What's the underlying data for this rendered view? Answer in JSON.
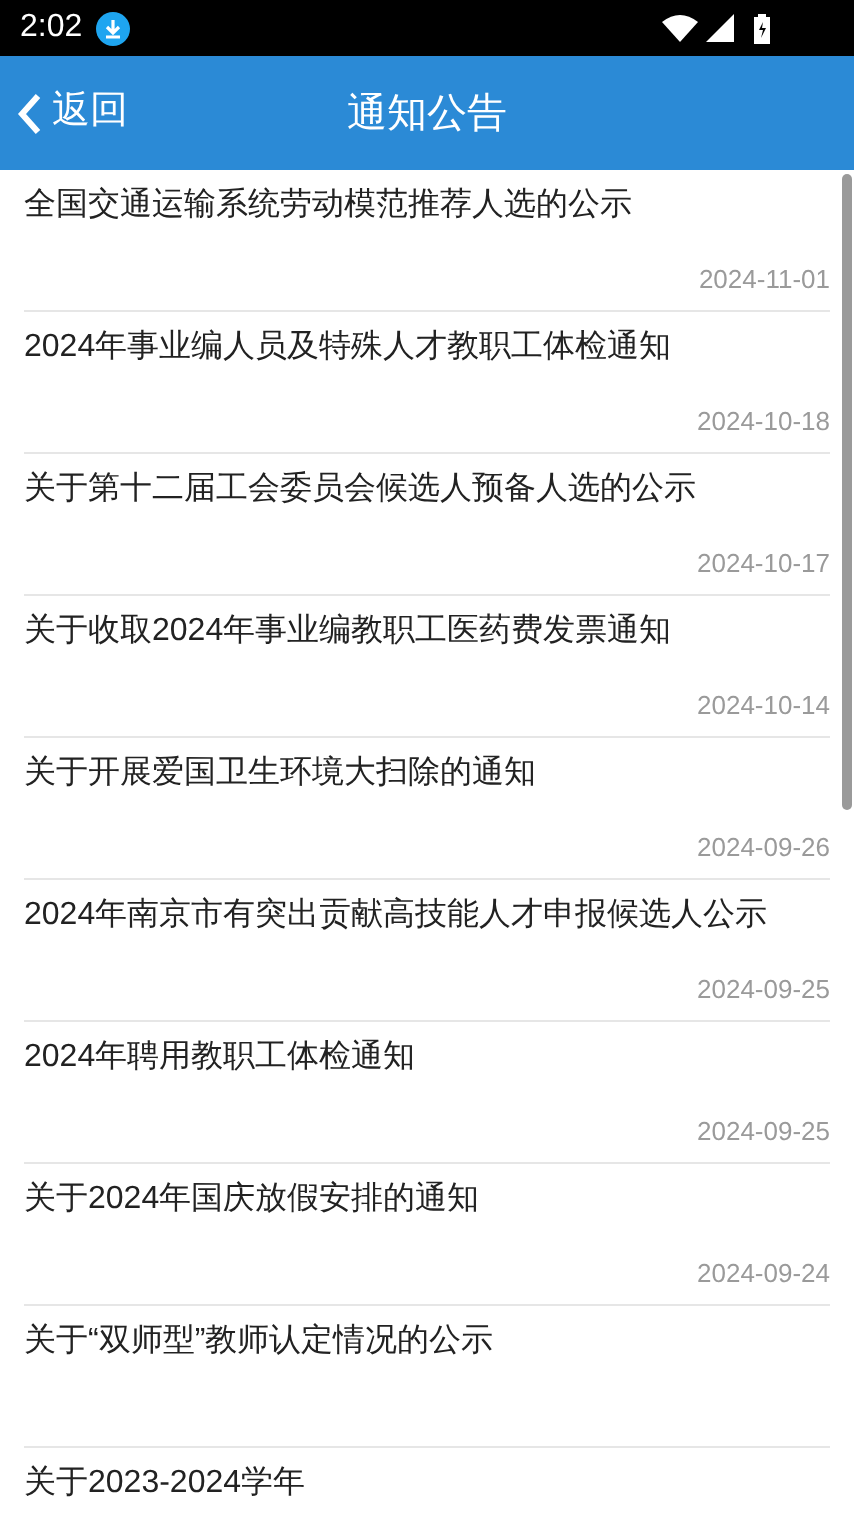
{
  "status_bar": {
    "time": "2:02"
  },
  "header": {
    "back": "返回",
    "title": "通知公告"
  },
  "notices": [
    {
      "title": "全国交通运输系统劳动模范推荐人选的公示",
      "date": "2024-11-01"
    },
    {
      "title": "2024年事业编人员及特殊人才教职工体检通知",
      "date": "2024-10-18"
    },
    {
      "title": "关于第十二届工会委员会候选人预备人选的公示",
      "date": "2024-10-17"
    },
    {
      "title": "关于收取2024年事业编教职工医药费发票通知",
      "date": "2024-10-14"
    },
    {
      "title": "关于开展爱国卫生环境大扫除的通知",
      "date": "2024-09-26"
    },
    {
      "title": "2024年南京市有突出贡献高技能人才申报候选人公示",
      "date": "2024-09-25"
    },
    {
      "title": "2024年聘用教职工体检通知",
      "date": "2024-09-25"
    },
    {
      "title": "关于2024年国庆放假安排的通知",
      "date": "2024-09-24"
    },
    {
      "title": "关于“双师型”教师认定情况的公示"
    },
    {
      "title": "关于2023-2024学年"
    }
  ]
}
